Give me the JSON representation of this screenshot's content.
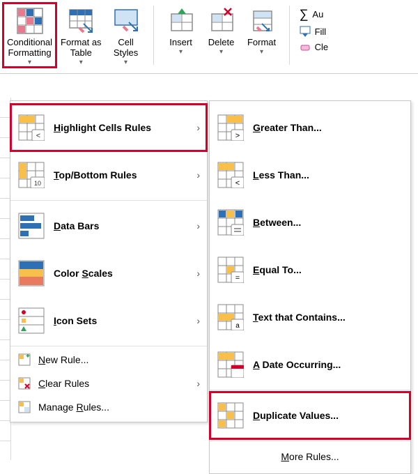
{
  "ribbon": {
    "conditional_formatting": "Conditional\nFormatting",
    "format_as_table": "Format as\nTable",
    "cell_styles": "Cell\nStyles",
    "insert": "Insert",
    "delete": "Delete",
    "format": "Format",
    "autosum": "Au",
    "fill": "Fill",
    "clear": "Cle"
  },
  "menu1": {
    "highlight_cells_rules": "Highlight Cells Rules",
    "top_bottom_rules": "Top/Bottom Rules",
    "data_bars": "Data Bars",
    "color_scales": "Color Scales",
    "icon_sets": "Icon Sets",
    "new_rule": "New Rule...",
    "clear_rules": "Clear Rules",
    "manage_rules": "Manage Rules..."
  },
  "menu2": {
    "greater_than": "Greater Than...",
    "less_than": "Less Than...",
    "between": "Between...",
    "equal_to": "Equal To...",
    "text_that_contains": "Text that Contains...",
    "a_date_occurring": "A Date Occurring...",
    "duplicate_values": "Duplicate Values...",
    "more_rules": "More Rules..."
  },
  "highlighted": [
    "conditional_formatting_button",
    "highlight_cells_rules_item",
    "duplicate_values_item"
  ]
}
